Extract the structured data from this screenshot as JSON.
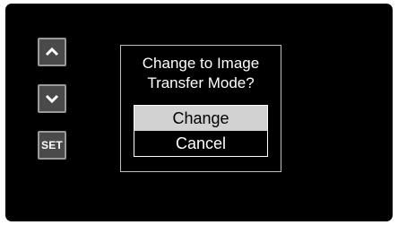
{
  "side_buttons": {
    "up_icon": "chevron-up-icon",
    "down_icon": "chevron-down-icon",
    "set_label": "SET"
  },
  "dialog": {
    "message_line1": "Change to Image",
    "message_line2": "Transfer Mode?",
    "options": [
      {
        "label": "Change",
        "selected": true
      },
      {
        "label": "Cancel",
        "selected": false
      }
    ]
  },
  "colors": {
    "screen_bg": "#000000",
    "button_bg": "#4a4a4a",
    "selected_bg": "#d2d2d2",
    "text": "#ffffff"
  }
}
